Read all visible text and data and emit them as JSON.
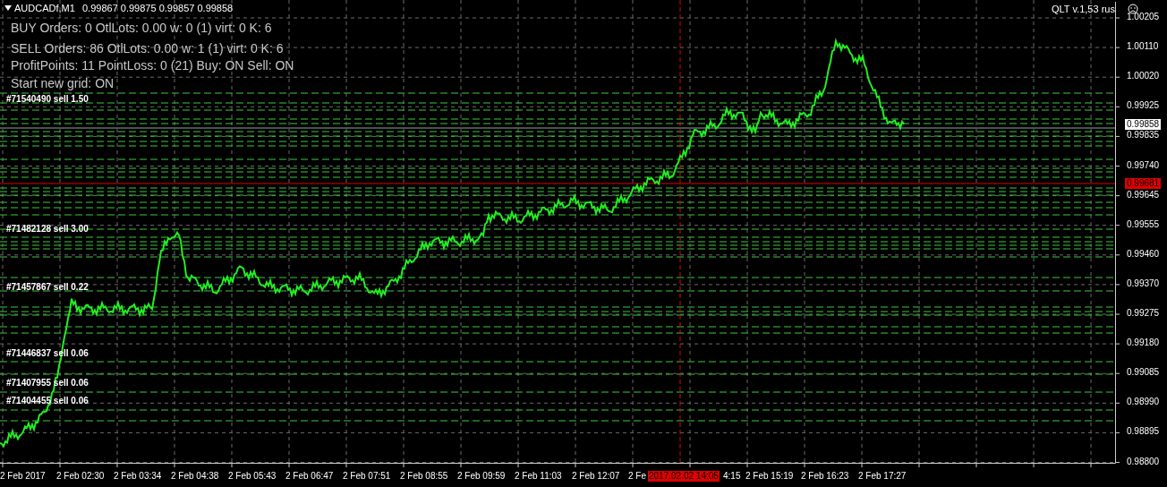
{
  "header": {
    "symbol": "AUDCADf,M1",
    "quote": "0.99867 0.99875 0.99857 0.99858"
  },
  "indicator": {
    "title": "QLT v.1,53 rus"
  },
  "info_lines": [
    "BUY  Orders: 0  OtlLots: 0.00  w: 0 (1)  virt: 0  K: 6",
    "SELL Orders: 86  OtlLots: 0.00  w: 1 (1)  virt: 0  K: 6",
    "ProfitPoints: 11  PointLoss: 0 (21) Buy: ON Sell: ON",
    "Start new grid: ON"
  ],
  "orders": [
    {
      "label": "#71540490 sell 1.50"
    },
    {
      "label": "#71482128 sell 3.00"
    },
    {
      "label": "#71457867 sell 0.22"
    },
    {
      "label": "#71446837 sell 0.06"
    },
    {
      "label": "#71407955 sell 0.06"
    },
    {
      "label": "#71404455 sell 0.06"
    }
  ],
  "price_axis": [
    "1.00205",
    "1.00110",
    "1.00020",
    "0.99925",
    "0.99835",
    "0.99740",
    "0.99645",
    "0.99555",
    "0.99460",
    "0.99370",
    "0.99275",
    "0.99180",
    "0.99085",
    "0.98990",
    "0.98895",
    "0.98800"
  ],
  "price_tags": [
    {
      "kind": "bid",
      "text": "0.99858"
    },
    {
      "kind": "crosshair",
      "text": "0.99681"
    }
  ],
  "time_axis": [
    "2 Feb 2017",
    "2 Feb 02:30",
    "2 Feb 03:34",
    "2 Feb 04:38",
    "2 Feb 05:43",
    "2 Feb 06:47",
    "2 Feb 07:51",
    "2 Feb 08:55",
    "2 Feb 09:59",
    "2 Feb 11:03",
    "2 Feb 12:07",
    "2 Fe",
    "4:15",
    "2 Feb 15:19",
    "2 Feb 16:23",
    "2 Feb 17:27"
  ],
  "crosshair_time": "2017.02.02 14:05"
}
